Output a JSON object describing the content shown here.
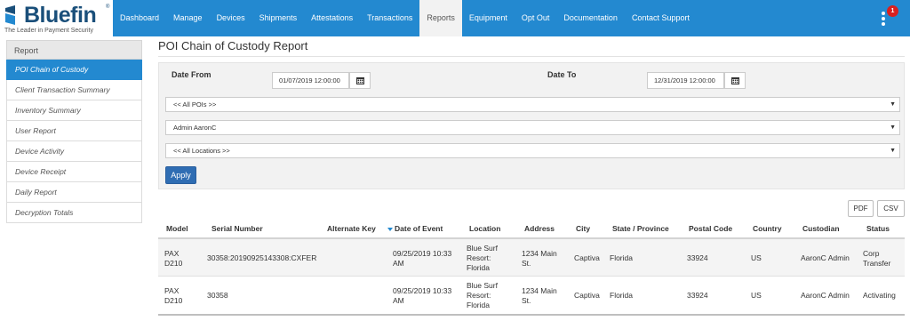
{
  "brand": {
    "name": "Bluefin",
    "tagline": "The Leader in Payment Security",
    "registered": "®"
  },
  "nav": {
    "items": [
      {
        "label": "Dashboard",
        "active": false
      },
      {
        "label": "Manage",
        "active": false
      },
      {
        "label": "Devices",
        "active": false
      },
      {
        "label": "Shipments",
        "active": false
      },
      {
        "label": "Attestations",
        "active": false
      },
      {
        "label": "Transactions",
        "active": false
      },
      {
        "label": "Reports",
        "active": true
      },
      {
        "label": "Equipment",
        "active": false
      },
      {
        "label": "Opt Out",
        "active": false
      },
      {
        "label": "Documentation",
        "active": false
      },
      {
        "label": "Contact Support",
        "active": false
      }
    ],
    "notification_count": "1",
    "menu_icon": "vertical-dots-icon"
  },
  "sidebar": {
    "heading": "Report",
    "items": [
      {
        "label": "POI Chain of Custody",
        "active": true
      },
      {
        "label": "Client Transaction Summary",
        "active": false
      },
      {
        "label": "Inventory Summary",
        "active": false
      },
      {
        "label": "User Report",
        "active": false
      },
      {
        "label": "Device Activity",
        "active": false
      },
      {
        "label": "Device Receipt",
        "active": false
      },
      {
        "label": "Daily Report",
        "active": false
      },
      {
        "label": "Decryption Totals",
        "active": false
      }
    ]
  },
  "page": {
    "title": "POI Chain of Custody Report"
  },
  "filters": {
    "date_from_label": "Date From",
    "date_from_value": "01/07/2019 12:00:00",
    "date_to_label": "Date To",
    "date_to_value": "12/31/2019 12:00:00",
    "poi_select": "<< All POIs >>",
    "user_select": "Admin AaronC",
    "location_select": "<< All Locations >>",
    "apply_label": "Apply"
  },
  "export": {
    "pdf_label": "PDF",
    "csv_label": "CSV"
  },
  "table": {
    "columns": [
      "Model",
      "Serial Number",
      "Alternate Key",
      "Date of Event",
      "Location",
      "Address",
      "City",
      "State / Province",
      "Postal Code",
      "Country",
      "Custodian",
      "Status"
    ],
    "rows": [
      {
        "model_line1": "PAX",
        "model_line2": "D210",
        "serial": "30358:20190925143308:CXFER",
        "alternate_key": "",
        "date_line1": "09/25/2019 10:33",
        "date_line2": "AM",
        "loc_line1": "Blue Surf",
        "loc_line2": "Resort:",
        "loc_line3": "Florida",
        "addr_line1": "1234 Main",
        "addr_line2": "St.",
        "city": "Captiva",
        "state": "Florida",
        "postal": "33924",
        "country": "US",
        "custodian": "AaronC Admin",
        "status_line1": "Corp",
        "status_line2": "Transfer"
      },
      {
        "model_line1": "PAX",
        "model_line2": "D210",
        "serial": "30358",
        "alternate_key": "",
        "date_line1": "09/25/2019 10:33",
        "date_line2": "AM",
        "loc_line1": "Blue Surf",
        "loc_line2": "Resort:",
        "loc_line3": "Florida",
        "addr_line1": "1234 Main",
        "addr_line2": "St.",
        "city": "Captiva",
        "state": "Florida",
        "postal": "33924",
        "country": "US",
        "custodian": "AaronC Admin",
        "status_line1": "Activating",
        "status_line2": ""
      }
    ]
  },
  "colors": {
    "nav_bg": "#2389d0",
    "brand_text": "#1a4f7a",
    "apply_bg": "#2f6db3",
    "badge": "#d9201f"
  }
}
